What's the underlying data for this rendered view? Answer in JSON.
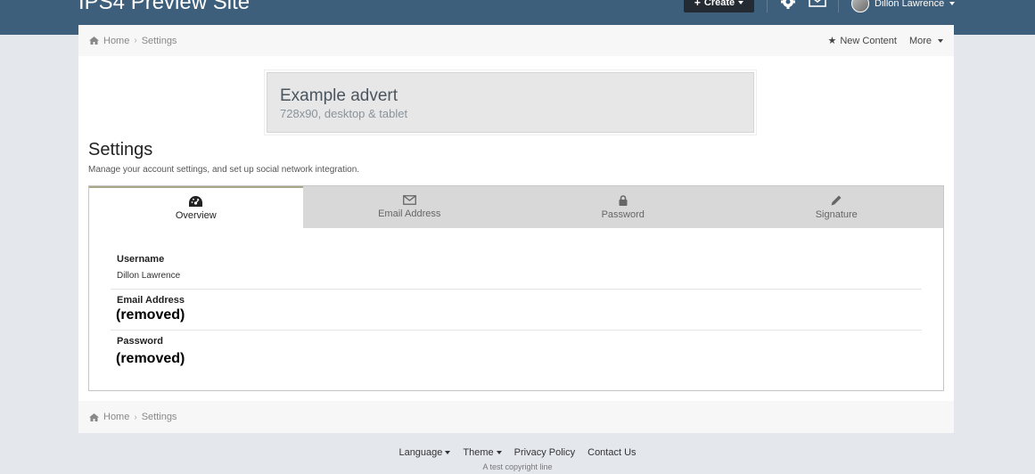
{
  "header": {
    "site_title": "IPS4 Preview Site",
    "create_label": "Create",
    "user_name": "Dillon Lawrence"
  },
  "breadcrumb": {
    "home": "Home",
    "current": "Settings",
    "new_content": "New Content",
    "more": "More"
  },
  "advert": {
    "title": "Example advert",
    "subtitle": "728x90, desktop & tablet"
  },
  "page": {
    "title": "Settings",
    "description": "Manage your account settings, and set up social network integration."
  },
  "tabs": [
    {
      "label": "Overview",
      "icon": "dashboard-icon",
      "active": true
    },
    {
      "label": "Email Address",
      "icon": "envelope-icon",
      "active": false
    },
    {
      "label": "Password",
      "icon": "lock-icon",
      "active": false
    },
    {
      "label": "Signature",
      "icon": "pencil-icon",
      "active": false
    }
  ],
  "fields": {
    "username_label": "Username",
    "username_value": "Dillon Lawrence",
    "email_label": "Email Address",
    "email_value": "(removed)",
    "password_label": "Password",
    "password_value": "(removed)"
  },
  "footer": {
    "language": "Language",
    "theme": "Theme",
    "privacy": "Privacy Policy",
    "contact": "Contact Us",
    "copyright": "A test copyright line"
  },
  "colors": {
    "header_bg": "#3d5f7c",
    "page_bg": "#e4e7ec",
    "tab_bg": "#d8d8d8",
    "active_tab_accent": "#a7a88a"
  }
}
